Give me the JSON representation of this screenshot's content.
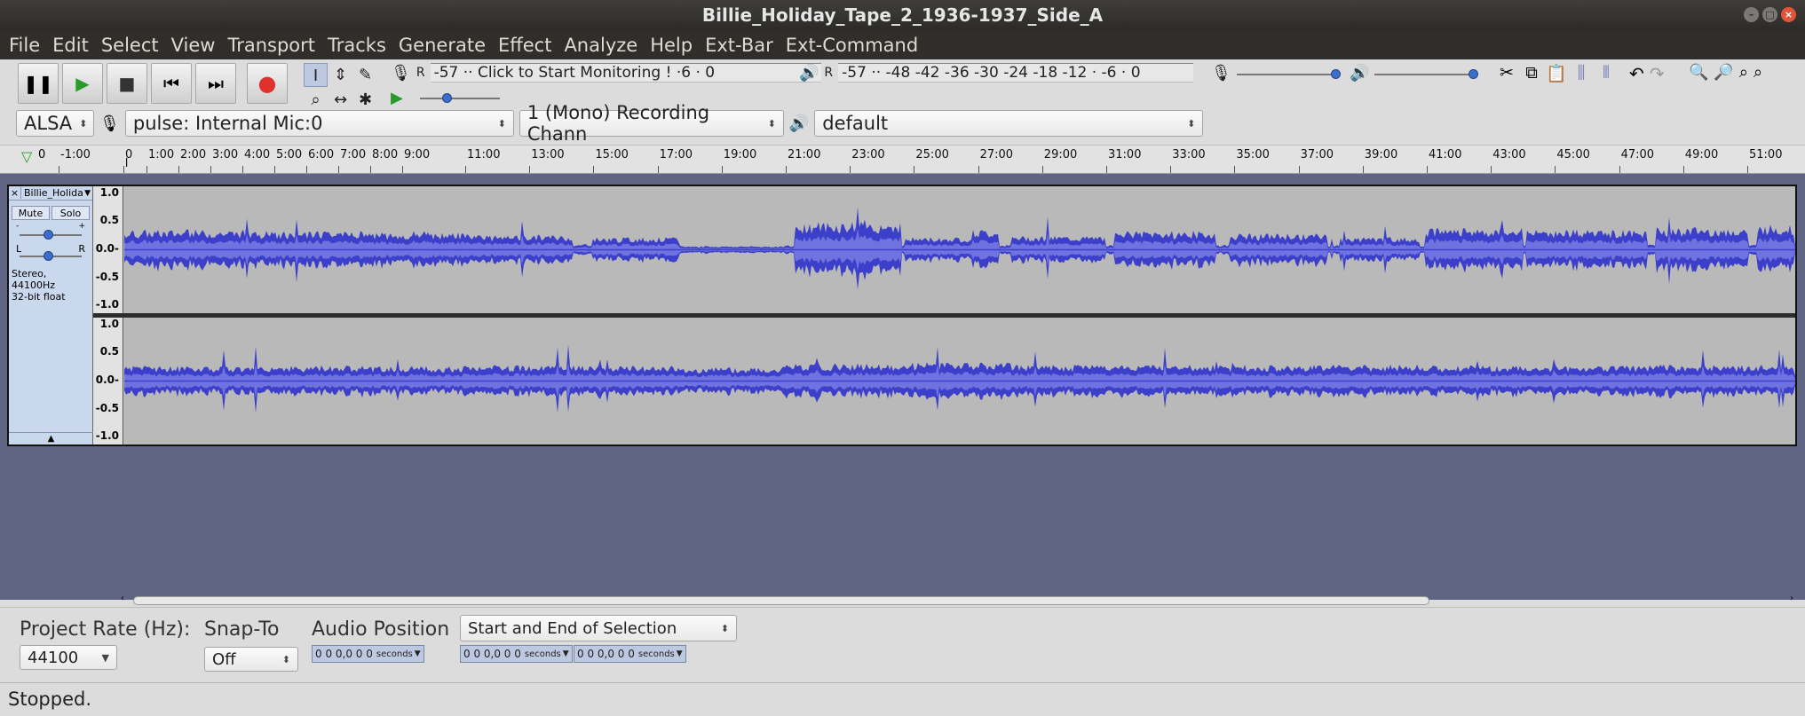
{
  "window": {
    "title": "Billie_Holiday_Tape_2_1936-1937_Side_A"
  },
  "menu": [
    "File",
    "Edit",
    "Select",
    "View",
    "Transport",
    "Tracks",
    "Generate",
    "Effect",
    "Analyze",
    "Help",
    "Ext-Bar",
    "Ext-Command"
  ],
  "recording_meter": {
    "label": "-57 ·· Click to Start Monitoring ! ·6 · 0"
  },
  "playback_meter": {
    "label": "-57 ·· -48 -42 -36 -30 -24 -18 -12 · -6 · 0"
  },
  "devices": {
    "host": "ALSA",
    "recording_device": "pulse: Internal Mic:0",
    "channels": "1 (Mono) Recording Chann",
    "playback_device": "default"
  },
  "ruler": [
    "-1:00",
    "0",
    "1:00",
    "2:00",
    "3:00",
    "4:00",
    "5:00",
    "6:00",
    "7:00",
    "8:00",
    "9:00",
    "11:00",
    "13:00",
    "15:00",
    "17:00",
    "19:00",
    "21:00",
    "23:00",
    "25:00",
    "27:00",
    "29:00",
    "31:00",
    "33:00",
    "35:00",
    "37:00",
    "39:00",
    "41:00",
    "43:00",
    "45:00",
    "47:00",
    "49:00",
    "51:00"
  ],
  "track": {
    "name": "Billie_Holida",
    "mute": "Mute",
    "solo": "Solo",
    "info_line1": "Stereo, 44100Hz",
    "info_line2": "32-bit float",
    "pan_left": "L",
    "pan_right": "R",
    "scale": [
      "1.0",
      "0.5",
      "0.0-",
      "-0.5",
      "-1.0"
    ]
  },
  "selection_toolbar": {
    "project_rate_label": "Project Rate (Hz):",
    "project_rate": "44100",
    "snap_to_label": "Snap-To",
    "snap_to": "Off",
    "audio_position_label": "Audio Position",
    "selection_mode": "Start and End of Selection",
    "audio_position": "0 0 0,0 0 0",
    "selection_start": "0 0 0,0 0 0",
    "selection_end": "0 0 0,0 0 0",
    "units": "seconds"
  },
  "status": "Stopped.",
  "colors": {
    "waveform": "#3b3fc9",
    "waveform_rms": "#6f73e0",
    "background": "#5f6482",
    "track_panel": "#cad8ee"
  }
}
